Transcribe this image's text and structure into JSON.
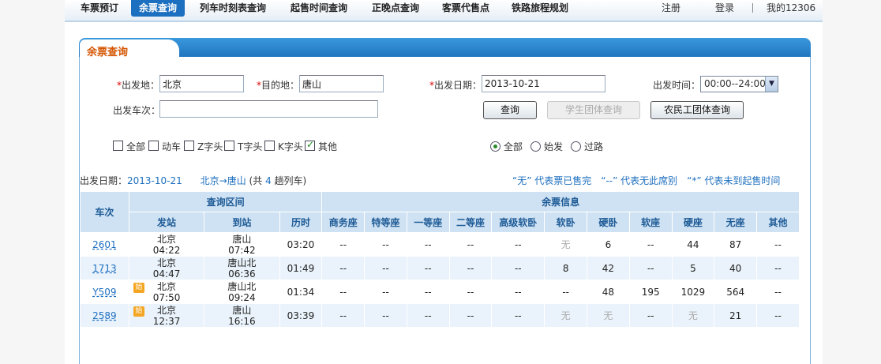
{
  "nav": {
    "items": [
      "车票预订",
      "余票查询",
      "列车时刻表查询",
      "起售时间查询",
      "正晚点查询",
      "客票代售点",
      "铁路旅程规划"
    ],
    "register": "注册",
    "login": "登录",
    "my12306": "我的12306"
  },
  "panel": {
    "title": "余票查询"
  },
  "form": {
    "from_label": "出发地：",
    "from_value": "北京",
    "to_label": "目的地：",
    "to_value": "唐山",
    "date_label": "出发日期：",
    "date_value": "2013-10-21",
    "time_label": "出发时间：",
    "time_value": "00:00--24:00",
    "train_label": "出发车次：",
    "train_value": "",
    "required_mark": "*",
    "query_btn": "查询",
    "student_btn": "学生团体查询",
    "worker_btn": "农民工团体查询",
    "train_types": [
      {
        "label": "全部",
        "checked": false
      },
      {
        "label": "动车",
        "checked": false
      },
      {
        "label": "Z字头",
        "checked": false
      },
      {
        "label": "T字头",
        "checked": false
      },
      {
        "label": "K字头",
        "checked": false
      },
      {
        "label": "其他",
        "checked": true
      }
    ],
    "station_types": [
      {
        "label": "全部",
        "checked": true
      },
      {
        "label": "始发",
        "checked": false
      },
      {
        "label": "过路",
        "checked": false
      }
    ]
  },
  "summary": {
    "date_label": "出发日期：",
    "date": "2013-10-21",
    "route": "北京→唐山",
    "count_prefix": "(共",
    "count": "4",
    "count_suffix": "趟列车)",
    "legend": "“无” 代表票已售完　“--” 代表无此席别　“*” 代表未到起售时间"
  },
  "table": {
    "group_headers": {
      "train": "车次",
      "interval": "查询区间",
      "tickets": "余票信息"
    },
    "interval_headers": [
      "发站",
      "到站",
      "历时"
    ],
    "seat_headers": [
      "商务座",
      "特等座",
      "一等座",
      "二等座",
      "高级软卧",
      "软卧",
      "硬卧",
      "软座",
      "硬座",
      "无座",
      "其他"
    ],
    "start_badge": "始",
    "rows": [
      {
        "train": "2601",
        "from": "北京",
        "dep": "04:22",
        "to": "唐山",
        "arr": "07:42",
        "dur": "03:20",
        "badge": false,
        "seats": [
          "--",
          "--",
          "--",
          "--",
          "--",
          "无",
          "6",
          "--",
          "44",
          "87",
          "--"
        ]
      },
      {
        "train": "1713",
        "from": "北京",
        "dep": "04:47",
        "to": "唐山北",
        "arr": "06:36",
        "dur": "01:49",
        "badge": false,
        "seats": [
          "--",
          "--",
          "--",
          "--",
          "--",
          "8",
          "42",
          "--",
          "5",
          "40",
          "--"
        ]
      },
      {
        "train": "Y509",
        "from": "北京",
        "dep": "07:50",
        "to": "唐山北",
        "arr": "09:24",
        "dur": "01:34",
        "badge": true,
        "seats": [
          "--",
          "--",
          "--",
          "--",
          "--",
          "--",
          "48",
          "195",
          "1029",
          "564",
          "--"
        ]
      },
      {
        "train": "2589",
        "from": "北京",
        "dep": "12:37",
        "to": "唐山",
        "arr": "16:16",
        "dur": "03:39",
        "badge": true,
        "seats": [
          "--",
          "--",
          "--",
          "--",
          "--",
          "无",
          "无",
          "--",
          "无",
          "21",
          "--"
        ]
      }
    ]
  }
}
